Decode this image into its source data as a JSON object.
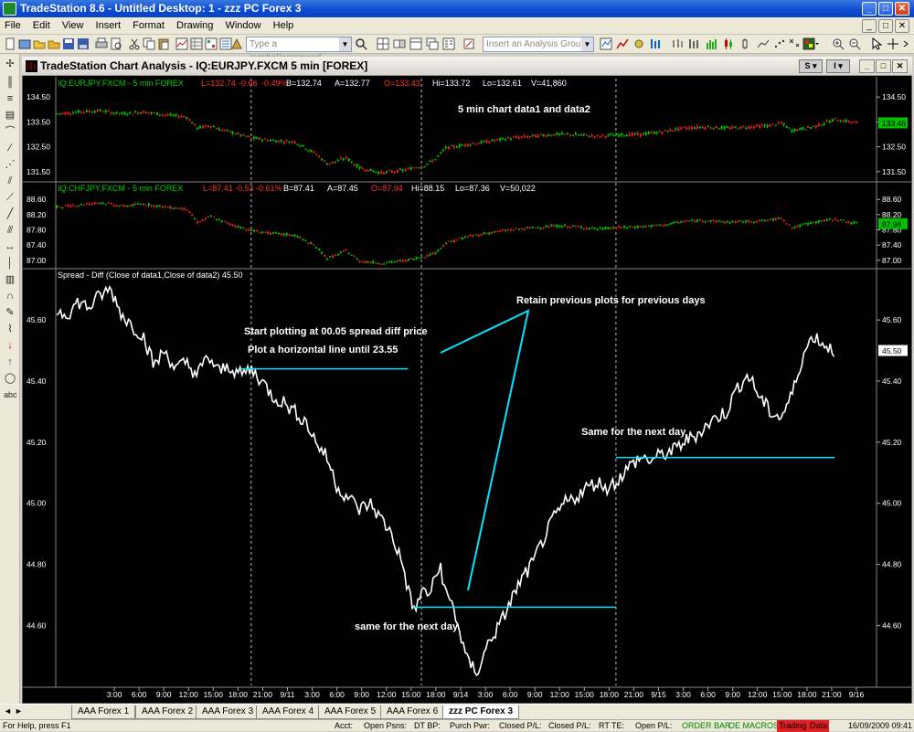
{
  "window": {
    "title": "TradeStation 8.6 - Untitled Desktop: 1 - zzz PC Forex 3"
  },
  "menu": [
    "File",
    "Edit",
    "View",
    "Insert",
    "Format",
    "Drawing",
    "Window",
    "Help"
  ],
  "toolbar": {
    "symbol_placeholder": "Type a symbol/command",
    "analysis_placeholder": "Insert an Analysis Group"
  },
  "chart_window": {
    "title": "TradeStation Chart Analysis - IQ:EURJPY.FXCM 5 min [FOREX]",
    "s_button": "S",
    "i_button": "I"
  },
  "chart_data": [
    {
      "type": "candlestick",
      "pane": "data1",
      "header": {
        "symbol": "IQ:EURJPY.FXCM - 5 min  FOREX",
        "last": "L=132.74",
        "net": "-0.66",
        "pct": "-0.49%",
        "bid": "B=132.74",
        "ask": "A=132.77",
        "open": "O=133.43",
        "high": "Hi=133.72",
        "low": "Lo=132.61",
        "volume": "V=41,860"
      },
      "y_ticks": [
        "134.50",
        "133.50",
        "132.50",
        "131.50"
      ],
      "y_tick_values": [
        134.5,
        133.5,
        132.5,
        131.5
      ],
      "ylim": [
        131.2,
        134.8
      ],
      "last_value_label": "133.46",
      "annotation": "5 min chart data1 and data2",
      "x": [
        0,
        8,
        16,
        24,
        32,
        40,
        48,
        52,
        54,
        57,
        60,
        64,
        72,
        80,
        88,
        96,
        100,
        103,
        107,
        112,
        120,
        128,
        136,
        140,
        144,
        152,
        160,
        168,
        176,
        184,
        192,
        200,
        208,
        216,
        224,
        232,
        240,
        248,
        256,
        264,
        268,
        272,
        280,
        288,
        296
      ],
      "values": [
        133.82,
        133.9,
        133.95,
        133.82,
        133.9,
        133.78,
        133.7,
        133.25,
        133.3,
        133.35,
        133.2,
        133.1,
        132.85,
        132.75,
        132.7,
        132.2,
        131.82,
        131.9,
        132.05,
        131.65,
        131.45,
        131.55,
        131.75,
        132.0,
        132.45,
        132.6,
        132.72,
        132.85,
        132.92,
        133.0,
        132.98,
        132.92,
        132.98,
        133.0,
        133.1,
        133.25,
        133.3,
        133.25,
        133.3,
        133.35,
        133.45,
        133.15,
        133.3,
        133.6,
        133.46
      ]
    },
    {
      "type": "candlestick",
      "pane": "data2",
      "header": {
        "symbol": "IQ:CHFJPY.FXCM - 5 min  FOREX",
        "last": "L=87.41",
        "net": "-0.53",
        "pct": "-0.61%",
        "bid": "B=87.41",
        "ask": "A=87.45",
        "open": "O=87.94",
        "high": "Hi=88.15",
        "low": "Lo=87.36",
        "volume": "V=50,022"
      },
      "y_ticks": [
        "88.60",
        "88.20",
        "87.80",
        "87.40",
        "87.00"
      ],
      "y_tick_values": [
        88.6,
        88.2,
        87.8,
        87.4,
        87.0
      ],
      "ylim": [
        86.85,
        88.75
      ],
      "last_value_label": "87.96",
      "x": [
        0,
        8,
        16,
        24,
        32,
        40,
        48,
        52,
        54,
        57,
        60,
        64,
        72,
        80,
        88,
        96,
        100,
        103,
        107,
        112,
        120,
        128,
        136,
        140,
        144,
        152,
        160,
        168,
        176,
        184,
        192,
        200,
        208,
        216,
        224,
        232,
        240,
        248,
        256,
        264,
        268,
        272,
        280,
        288,
        296
      ],
      "values": [
        88.4,
        88.45,
        88.52,
        88.42,
        88.48,
        88.4,
        88.35,
        88.0,
        88.05,
        88.15,
        88.05,
        87.95,
        87.78,
        87.7,
        87.66,
        87.35,
        87.05,
        87.12,
        87.25,
        86.98,
        86.92,
        86.98,
        87.1,
        87.2,
        87.45,
        87.62,
        87.72,
        87.8,
        87.85,
        87.9,
        87.88,
        87.82,
        87.86,
        87.88,
        87.92,
        88.02,
        88.05,
        88.0,
        88.02,
        88.05,
        88.12,
        87.85,
        88.0,
        88.08,
        87.96
      ]
    },
    {
      "type": "line",
      "pane": "spread",
      "title": "Spread - Diff (Close of data1,Close of data2)   45.50",
      "y_ticks": [
        "45.60",
        "45.40",
        "45.20",
        "45.00",
        "44.80",
        "44.60"
      ],
      "y_tick_values": [
        45.6,
        45.4,
        45.2,
        45.0,
        44.8,
        44.6
      ],
      "ylim": [
        44.41,
        45.72
      ],
      "last_value_label": "45.50",
      "x_ticks": [
        "3:00",
        "6:00",
        "9:00",
        "12:00",
        "15:00",
        "18:00",
        "21:00",
        "9/11",
        "3:00",
        "6:00",
        "9:00",
        "12:00",
        "15:00",
        "18:00",
        "9/14",
        "3:00",
        "6:00",
        "9:00",
        "12:00",
        "15:00",
        "18:00",
        "21:00",
        "9/15",
        "3:00",
        "6:00",
        "9:00",
        "12:00",
        "15:00",
        "18:00",
        "21:00",
        "9/16"
      ],
      "x_tick_positions": [
        9,
        18,
        27,
        36,
        45,
        54,
        63,
        72,
        81,
        90,
        99,
        108,
        117,
        126,
        135,
        144,
        153,
        162,
        171,
        180,
        189,
        198,
        207,
        216,
        225,
        234,
        243,
        252,
        261,
        270,
        279
      ],
      "day_separators": [
        72,
        135,
        207
      ],
      "x": [
        0,
        4,
        8,
        12,
        16,
        20,
        24,
        28,
        32,
        36,
        40,
        44,
        48,
        52,
        56,
        60,
        64,
        68,
        72,
        76,
        80,
        84,
        88,
        92,
        96,
        100,
        104,
        108,
        112,
        116,
        120,
        124,
        128,
        130,
        132,
        134,
        136,
        138,
        140,
        142,
        144,
        146,
        148,
        150,
        152,
        156,
        160,
        164,
        168,
        172,
        176,
        180,
        184,
        188,
        192,
        196,
        200,
        204,
        208,
        212,
        216,
        220,
        224,
        228,
        232,
        236,
        240,
        244,
        248,
        252,
        256,
        260,
        264,
        268,
        272,
        276,
        280,
        284,
        288
      ],
      "values": [
        45.63,
        45.62,
        45.66,
        45.64,
        45.68,
        45.7,
        45.62,
        45.58,
        45.55,
        45.45,
        45.5,
        45.44,
        45.46,
        45.42,
        45.48,
        45.43,
        45.45,
        45.42,
        45.44,
        45.4,
        45.35,
        45.33,
        45.3,
        45.27,
        45.2,
        45.15,
        45.05,
        45.02,
        44.98,
        45.0,
        44.95,
        44.9,
        44.8,
        44.72,
        44.65,
        44.68,
        44.72,
        44.7,
        44.75,
        44.8,
        44.7,
        44.68,
        44.62,
        44.55,
        44.48,
        44.45,
        44.55,
        44.6,
        44.68,
        44.75,
        44.8,
        44.88,
        44.95,
        45.0,
        45.02,
        45.05,
        45.07,
        45.05,
        45.08,
        45.12,
        45.15,
        45.14,
        45.16,
        45.17,
        45.2,
        45.22,
        45.25,
        45.28,
        45.3,
        45.38,
        45.42,
        45.35,
        45.3,
        45.28,
        45.35,
        45.48,
        45.55,
        45.52,
        45.5
      ],
      "horizontal_levels": [
        {
          "x_start": 68,
          "x_end": 130,
          "value": 45.44
        },
        {
          "x_start": 132,
          "x_end": 207,
          "value": 44.66
        },
        {
          "x_start": 207,
          "x_end": 288,
          "value": 45.15
        }
      ],
      "annotations": [
        "Start plotting at 00.05 spread diff price",
        "Plot a horizontal line until 23.55",
        "Retain previous plots for previous days",
        "Same for the next day",
        "same for the next day"
      ]
    }
  ],
  "colors": {
    "background": "#000000",
    "line": "#ffffff",
    "level_line": "#00e5ff",
    "up": "#00c800",
    "down": "#e02020",
    "last_badge": "#00c000",
    "header_green": "#00d000",
    "header_red": "#ff3030"
  },
  "tabs": [
    "AAA Forex 1",
    "AAA Forex 2",
    "AAA Forex 3",
    "AAA Forex 4",
    "AAA Forex 5",
    "AAA Forex 6",
    "zzz PC Forex 3"
  ],
  "status": {
    "help": "For Help, press F1",
    "acct": "Acct:",
    "open_psns": "Open Psns:",
    "dt_bp": "DT BP:",
    "purch_pwr": "Purch Pwr:",
    "closed_pl1": "Closed P/L:",
    "closed_pl2": "Closed P/L:",
    "rt_te": "RT TE:",
    "open_pl": "Open P/L:",
    "order_bar": "ORDER BAR",
    "oe_macros": "OE MACROS",
    "trading": "Trading",
    "data": "Data",
    "datetime": "16/09/2009 09:41"
  }
}
